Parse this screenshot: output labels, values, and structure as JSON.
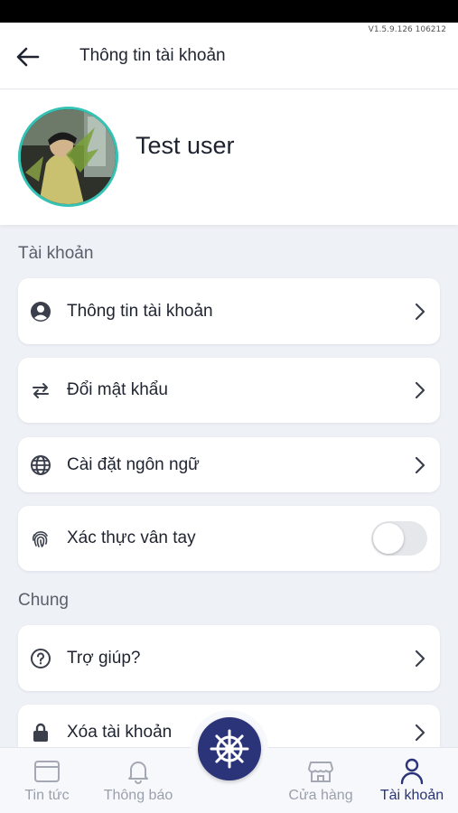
{
  "app": {
    "version": "V1.5.9.126 106212",
    "title": "Thông tin tài khoản"
  },
  "profile": {
    "name": "Test user"
  },
  "sections": {
    "account": {
      "label": "Tài khoản",
      "items": [
        {
          "label": "Thông tin tài khoản",
          "icon": "user-circle-icon"
        },
        {
          "label": "Đổi mật khẩu",
          "icon": "swap-arrows-icon"
        },
        {
          "label": "Cài đặt ngôn ngữ",
          "icon": "globe-icon"
        },
        {
          "label": "Xác thực vân tay",
          "icon": "fingerprint-icon",
          "toggle": false
        }
      ]
    },
    "general": {
      "label": "Chung",
      "items": [
        {
          "label": "Trợ giúp?",
          "icon": "help-circle-icon"
        },
        {
          "label": "Xóa tài khoản",
          "icon": "lock-icon"
        }
      ]
    }
  },
  "bottom_nav": {
    "items": [
      {
        "label": "Tin tức",
        "icon": "news-icon"
      },
      {
        "label": "Thông báo",
        "icon": "bell-icon"
      },
      {
        "label": "Cửa hàng",
        "icon": "store-icon"
      },
      {
        "label": "Tài khoản",
        "icon": "person-icon",
        "active": true
      }
    ],
    "center_icon": "ship-wheel-icon"
  },
  "colors": {
    "accent": "#2b3478",
    "avatar_ring": "#33c2b3",
    "background": "#eef1f6"
  }
}
